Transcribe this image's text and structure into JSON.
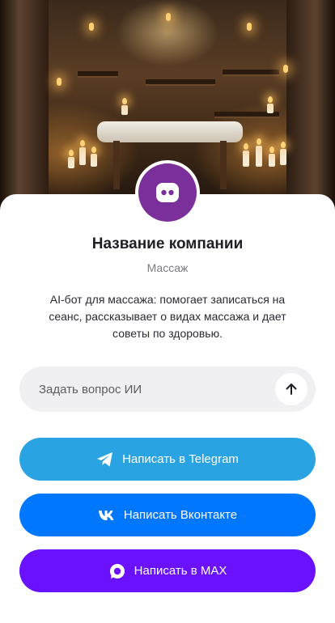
{
  "company": {
    "name": "Название компании",
    "category": "Массаж",
    "description": "AI-бот для массажа: помогает записаться на сеанс, рассказывает о видах массажа и дает советы по здоровью."
  },
  "ask": {
    "placeholder": "Задать вопрос ИИ",
    "send_icon": "arrow-up-icon"
  },
  "buttons": {
    "telegram": {
      "label": "Написать в Telegram",
      "icon": "telegram-icon",
      "color": "#2aa3e2"
    },
    "vk": {
      "label": "Написать Вконтакте",
      "icon": "vk-icon",
      "color": "#0077ff"
    },
    "max": {
      "label": "Написать в MAX",
      "icon": "max-icon",
      "color": "#6a11ff"
    }
  },
  "colors": {
    "avatar_bg": "#7a2f9a",
    "ask_bg": "#f0f0f3"
  }
}
